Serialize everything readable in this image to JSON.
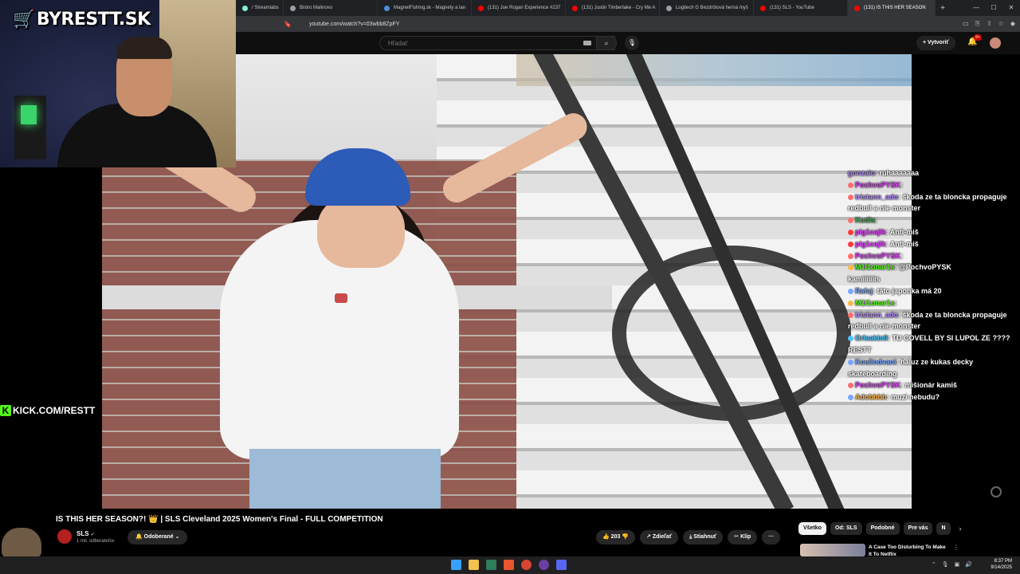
{
  "browser": {
    "tabs": [
      {
        "label": "/ Streamlabs",
        "color": "#80f2d3",
        "active": false
      },
      {
        "label": "Bistro Malinovo",
        "color": "#9aa0a6",
        "active": false
      },
      {
        "label": "MagnetFishing.sk - Magnety a lan",
        "color": "#4a8fe0",
        "active": false
      },
      {
        "label": "(131) Joe Rogan Experience #237",
        "color": "#ff0000",
        "active": false
      },
      {
        "label": "(131) Justin Timberlake - Cry Me A",
        "color": "#ff0000",
        "active": false
      },
      {
        "label": "Logitech G Bezdrôtová herná myš",
        "color": "#9aa0a6",
        "active": false
      },
      {
        "label": "(131) SLS - YouTube",
        "color": "#ff0000",
        "active": false
      },
      {
        "label": "(131) IS THIS HER SEASON",
        "color": "#ff0000",
        "active": true
      }
    ],
    "new_tab": "+",
    "url": "youtube.com/watch?v=03wbb8ZpFY"
  },
  "youtube": {
    "search_placeholder": "Hľadať",
    "create_label": "+ Vytvoriť",
    "notif_count": "9+",
    "video_title": "IS THIS HER SEASON?! 👑 | SLS Cleveland 2025 Women's Final - FULL COMPETITION",
    "channel_name": "SLS",
    "channel_subs": "1 mil. odberateľov",
    "subscribe_label": "Odoberané",
    "likes": "203",
    "actions": {
      "share": "Zdieľať",
      "download": "Stiahnuť",
      "clip": "Klip",
      "more": "···"
    },
    "chips": [
      "Všetko",
      "Od: SLS",
      "Podobné",
      "Pre vás",
      "N"
    ],
    "rec_title": "A Case Too Disturbing To Make It To Netflix"
  },
  "overlay": {
    "logo_text": "BYRESTT.SK",
    "kick_text": "KICK.COM/RESTT",
    "chat": [
      {
        "user": "gonzalo",
        "color": "#b388ff",
        "badge": "",
        "text": "ruhaaaaaaa"
      },
      {
        "user": "PochvoPYSK",
        "color": "#e040fb",
        "badge": "#ff6f6f",
        "text": ""
      },
      {
        "user": "tristann_ado",
        "color": "#b388ff",
        "badge": "#ff6f6f",
        "text": "škoda ze ta bloncka propaguje redbull a nie monster"
      },
      {
        "user": "Kudla",
        "color": "#4caf50",
        "badge": "#ff6f6f",
        "text": ""
      },
      {
        "user": "pig1cajik",
        "color": "#e040fb",
        "badge": "#ff3b3b",
        "text": "Anti-miš"
      },
      {
        "user": "pig1cajik",
        "color": "#e040fb",
        "badge": "#ff3b3b",
        "text": "Anti-miš"
      },
      {
        "user": "PochvoPYSK",
        "color": "#e040fb",
        "badge": "#ff6f6f",
        "text": ""
      },
      {
        "user": "M1l1onar1s",
        "color": "#53fc18",
        "badge": "#ffb74d",
        "text": "@PochvoPYSK"
      },
      {
        "user": "",
        "color": "#ffffff",
        "badge": "",
        "text": "kamiiiiiiis"
      },
      {
        "user": "Rafaj",
        "color": "#7aa7ff",
        "badge": "#7aa7ff",
        "text": "táto japonka má 20"
      },
      {
        "user": "M1l1onar1s",
        "color": "#53fc18",
        "badge": "#ffb74d",
        "text": ""
      },
      {
        "user": "tristann_ado",
        "color": "#b388ff",
        "badge": "#ff6f6f",
        "text": "škoda ze ta bloncka propaguje redbull a nie monster"
      },
      {
        "user": "Orleakin9",
        "color": "#4fc3f7",
        "badge": "#4fc3f7",
        "text": "TU COVELL BY SI LUPOL ZE ???? RESTT"
      },
      {
        "user": "Koulindvani",
        "color": "#7aa7ff",
        "badge": "#7aa7ff",
        "text": "haluz ze kukas decky skateboarding"
      },
      {
        "user": "PochvoPYSK",
        "color": "#e040fb",
        "badge": "#ff6f6f",
        "text": "mišionár kamiš"
      },
      {
        "user": "Adobbbb",
        "color": "#ffb74d",
        "badge": "#7aa7ff",
        "text": "muzi nebudu?"
      }
    ]
  },
  "taskbar": {
    "time": "8:37 PM",
    "date": "9/14/2025"
  },
  "colors": {
    "kick_green": "#53fc18",
    "yt_red": "#ff0000",
    "helmet_blue": "#2c5bb8"
  }
}
